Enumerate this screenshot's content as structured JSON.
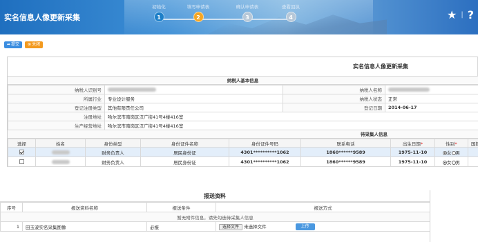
{
  "header": {
    "title": "实名信息人像更新采集",
    "steps": [
      {
        "label": "初始化",
        "num": "1",
        "state": "done"
      },
      {
        "label": "填写申请表",
        "num": "2",
        "state": "active"
      },
      {
        "label": "确认申请表",
        "num": "3",
        "state": "todo"
      },
      {
        "label": "查看回执",
        "num": "4",
        "state": "todo"
      }
    ],
    "icons": [
      "star-icon",
      "help-icon"
    ],
    "star": "★",
    "sep": "|",
    "help": "?"
  },
  "toolbar": {
    "submit_label": "提交",
    "close_label": "关闭"
  },
  "form": {
    "title": "实名信息人像更新采集",
    "basic_section": "纳税人基本信息",
    "fields": {
      "taxpayer_id_label": "纳税人识别号",
      "taxpayer_name_label": "纳税人名称",
      "industry_label": "所属行业",
      "industry_value": "专业设计服务",
      "status_label": "纳税人状态",
      "status_value": "正常",
      "reg_type_label": "登记注册类型",
      "reg_type_value": "其他有限责任公司",
      "reg_date_label": "登记日期",
      "reg_date_value": "2014-06-17",
      "reg_addr_label": "注册地址",
      "reg_addr_value": "哈尔滨市南岗区汉广街41号4楼416室",
      "biz_addr_label": "生产经营地址",
      "biz_addr_value": "哈尔滨市南岗区汉广街41号4楼416室"
    },
    "gather_section": "待采集人信息",
    "gather_headers": [
      "选择",
      "姓名",
      "身份类型",
      "身份证件名称",
      "身份证件号码",
      "联系电话",
      "出生日期",
      "性别",
      "国籍"
    ],
    "gather_rows": [
      {
        "checked": true,
        "role": "财务负责人",
        "id_name": "居民身份证",
        "id_no": "4301**********1062",
        "phone": "1860******9589",
        "birth": "1975-11-10",
        "female": "女",
        "male": "男"
      },
      {
        "checked": false,
        "role": "财务负责人",
        "id_name": "居民身份证",
        "id_no": "4301**********1062",
        "phone": "1860******9589",
        "birth": "1975-11-10",
        "female": "女",
        "male": "男"
      }
    ]
  },
  "report": {
    "title": "报送资料",
    "headers": [
      "序号",
      "报送资料名称",
      "报送条件",
      "报送方式"
    ],
    "notice": "暂无附件信息，请先勾选待采集人信息",
    "rows": [
      {
        "no": "1",
        "name": "田玉波实名采集图像",
        "cond": "必报",
        "choose": "选择文件",
        "nofile": "未选择文件",
        "upload": "上传"
      }
    ]
  }
}
